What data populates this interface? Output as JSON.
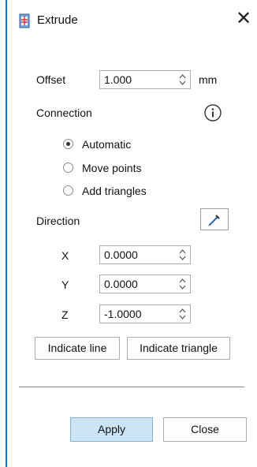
{
  "window": {
    "title": "Extrude",
    "icon": "extrude-app-icon",
    "close_icon": "close-icon"
  },
  "offset": {
    "label": "Offset",
    "value": "1.000",
    "unit": "mm"
  },
  "connection": {
    "label": "Connection",
    "info_icon": "info-icon",
    "options": [
      {
        "label": "Automatic",
        "selected": true
      },
      {
        "label": "Move points",
        "selected": false
      },
      {
        "label": "Add triangles",
        "selected": false
      }
    ]
  },
  "direction": {
    "label": "Direction",
    "pick_icon": "pick-direction-icon",
    "x": {
      "label": "X",
      "value": "0.0000"
    },
    "y": {
      "label": "Y",
      "value": "0.0000"
    },
    "z": {
      "label": "Z",
      "value": "-1.0000"
    },
    "indicate_line_label": "Indicate line",
    "indicate_triangle_label": "Indicate triangle"
  },
  "footer": {
    "apply_label": "Apply",
    "close_label": "Close"
  },
  "colors": {
    "accent_edge": "#0078d7",
    "primary_button_bg": "#cce4f7"
  }
}
